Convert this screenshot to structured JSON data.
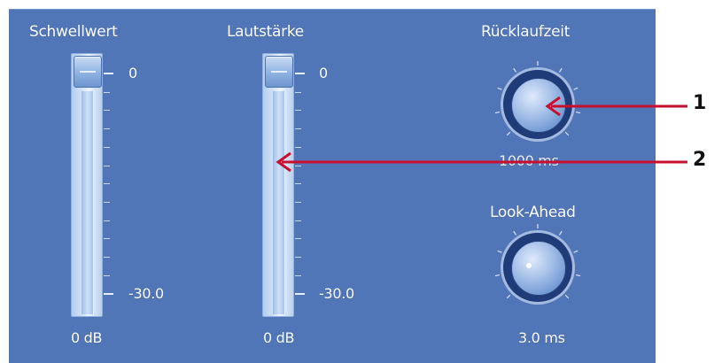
{
  "compressor": {
    "threshold": {
      "title": "Schwellwert",
      "scale_top": "0",
      "scale_bottom": "-30.0",
      "value": "0 dB",
      "level_fraction": 1.0
    },
    "volume": {
      "title": "Lautstärke",
      "scale_top": "0",
      "scale_bottom": "-30.0",
      "value": "0 dB",
      "level_fraction": 1.0
    },
    "release": {
      "title": "Rücklaufzeit",
      "value": "1000 ms"
    },
    "lookahead": {
      "title": "Look-Ahead",
      "value": "3.0 ms"
    }
  },
  "callouts": [
    {
      "number": "1",
      "target": "release-knob"
    },
    {
      "number": "2",
      "target": "volume-slider"
    }
  ],
  "colors": {
    "panel_background": "#5176b8",
    "callout_arrow": "#c8102e",
    "text": "#ffffff"
  }
}
